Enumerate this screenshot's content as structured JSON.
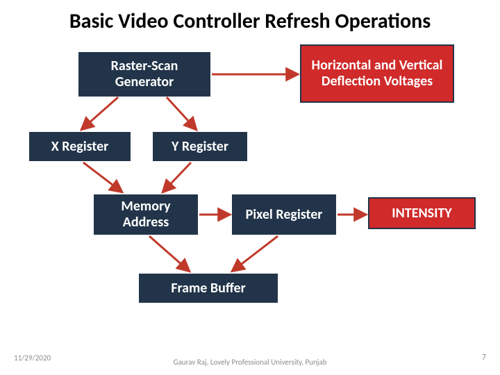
{
  "title": "Basic Video Controller Refresh Operations",
  "boxes": {
    "raster": "Raster-Scan Generator",
    "deflection": "Horizontal and Vertical  Deflection Voltages",
    "xreg": "X   Register",
    "yreg": "Y Register",
    "memaddr": "Memory Address",
    "pixelreg": "Pixel Register",
    "intensity": "INTENSITY",
    "framebuf": "Frame Buffer"
  },
  "footer": {
    "date": "11/29/2020",
    "center": "Gaurav Raj, Lovely Professional University, Punjab",
    "page": "7"
  },
  "colors": {
    "dark": "#223449",
    "red": "#d02a2a"
  }
}
